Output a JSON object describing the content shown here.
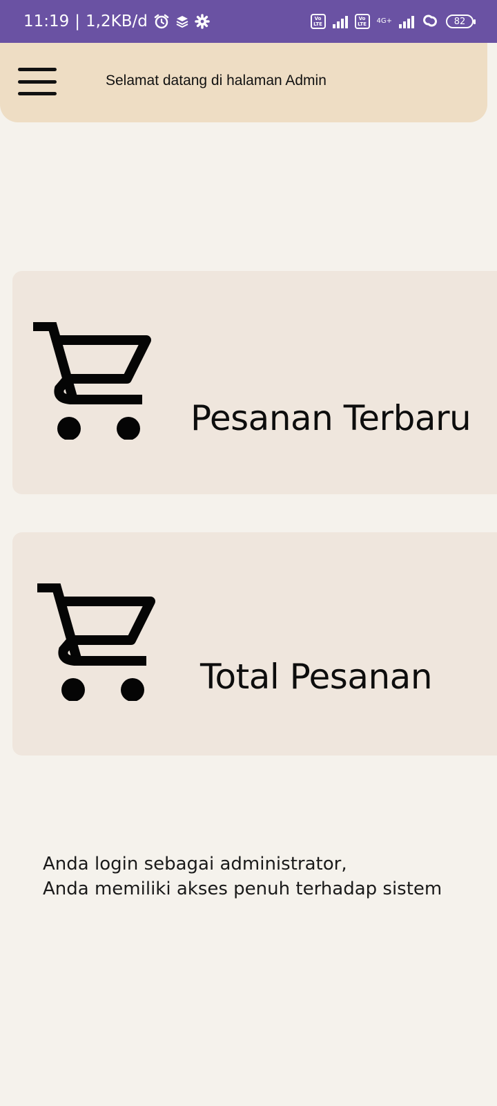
{
  "status_bar": {
    "time": "11:19",
    "data_rate": "1,2KB/d",
    "icons_left": [
      "alarm-icon",
      "layers-icon",
      "gear-icon"
    ],
    "volte_1": "Vo LTE",
    "volte_2": "Vo LTE",
    "network_type": "4G+",
    "battery_level": "82"
  },
  "header": {
    "menu_icon": "hamburger-menu-icon",
    "title": "Selamat datang di halaman Admin",
    "background_color": "#eeddc4"
  },
  "cards": [
    {
      "icon": "shopping-cart-icon",
      "label": "Pesanan Terbaru"
    },
    {
      "icon": "shopping-cart-icon",
      "label": "Total Pesanan"
    }
  ],
  "info": {
    "line1": "Anda login sebagai administrator,",
    "line2": "Anda memiliki akses penuh terhadap sistem"
  },
  "colors": {
    "status_bar": "#6a52a3",
    "page_background": "#f5f2ec",
    "card_background": "#efe6dd"
  }
}
